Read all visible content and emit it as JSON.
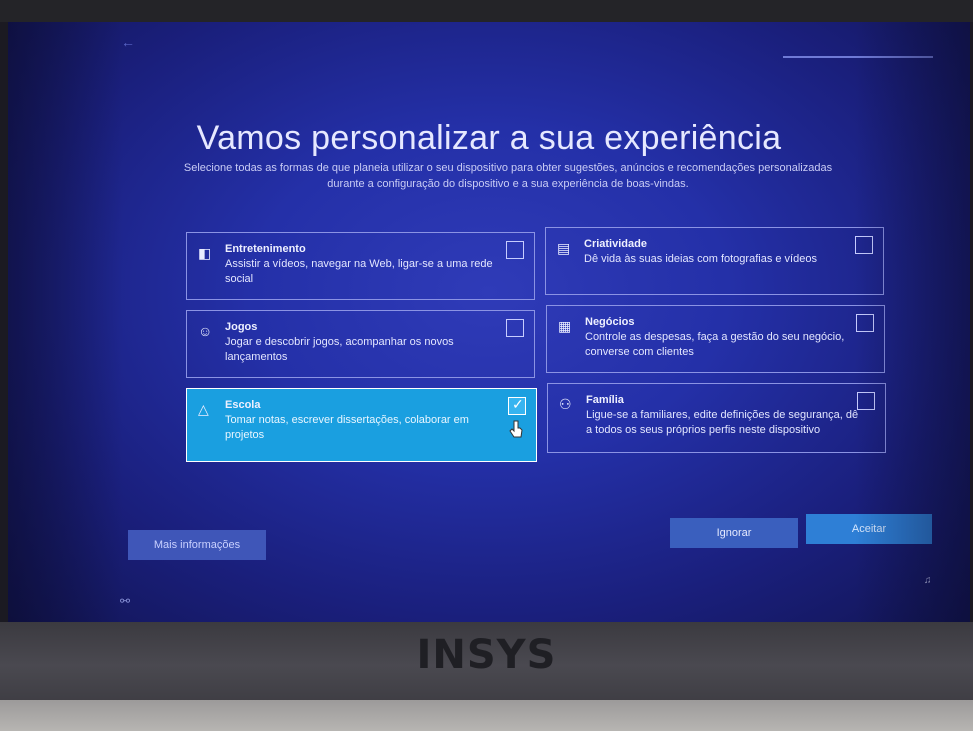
{
  "title": "Vamos personalizar a sua experiência",
  "subtitle_line1": "Selecione todas as formas de que planeia utilizar o seu dispositivo para obter sugestões, anúncios e recomendações personalizadas",
  "subtitle_line2": "durante a configuração do dispositivo e a sua experiência de boas-vindas.",
  "options": [
    {
      "name": "Entretenimento",
      "desc": "Assistir a vídeos, navegar na Web, ligar-se a uma rede social",
      "icon": "entertainment-icon",
      "selected": false
    },
    {
      "name": "Criatividade",
      "desc": "Dê vida às suas ideias com fotografias e vídeos",
      "icon": "picture-icon",
      "selected": false
    },
    {
      "name": "Jogos",
      "desc": "Jogar e descobrir jogos, acompanhar os novos lançamentos",
      "icon": "gaming-icon",
      "selected": false
    },
    {
      "name": "Negócios",
      "desc": "Controle as despesas, faça a gestão do seu negócio, converse com clientes",
      "icon": "business-icon",
      "selected": false
    },
    {
      "name": "Escola",
      "desc": "Tomar notas, escrever dissertações, colaborar em projetos",
      "icon": "graduation-cap-icon",
      "selected": true
    },
    {
      "name": "Família",
      "desc": "Ligue-se a familiares, edite definições de segurança, dê a todos os seus próprios perfis neste dispositivo",
      "icon": "family-icon",
      "selected": false
    }
  ],
  "buttons": {
    "more_info": "Mais informações",
    "skip": "Ignorar",
    "accept": "Aceitar"
  },
  "brand": "INSYS",
  "colors": {
    "selected_card": "#1a9fe0",
    "accept_button": "#2e7fd6",
    "background": "#2430a8"
  }
}
